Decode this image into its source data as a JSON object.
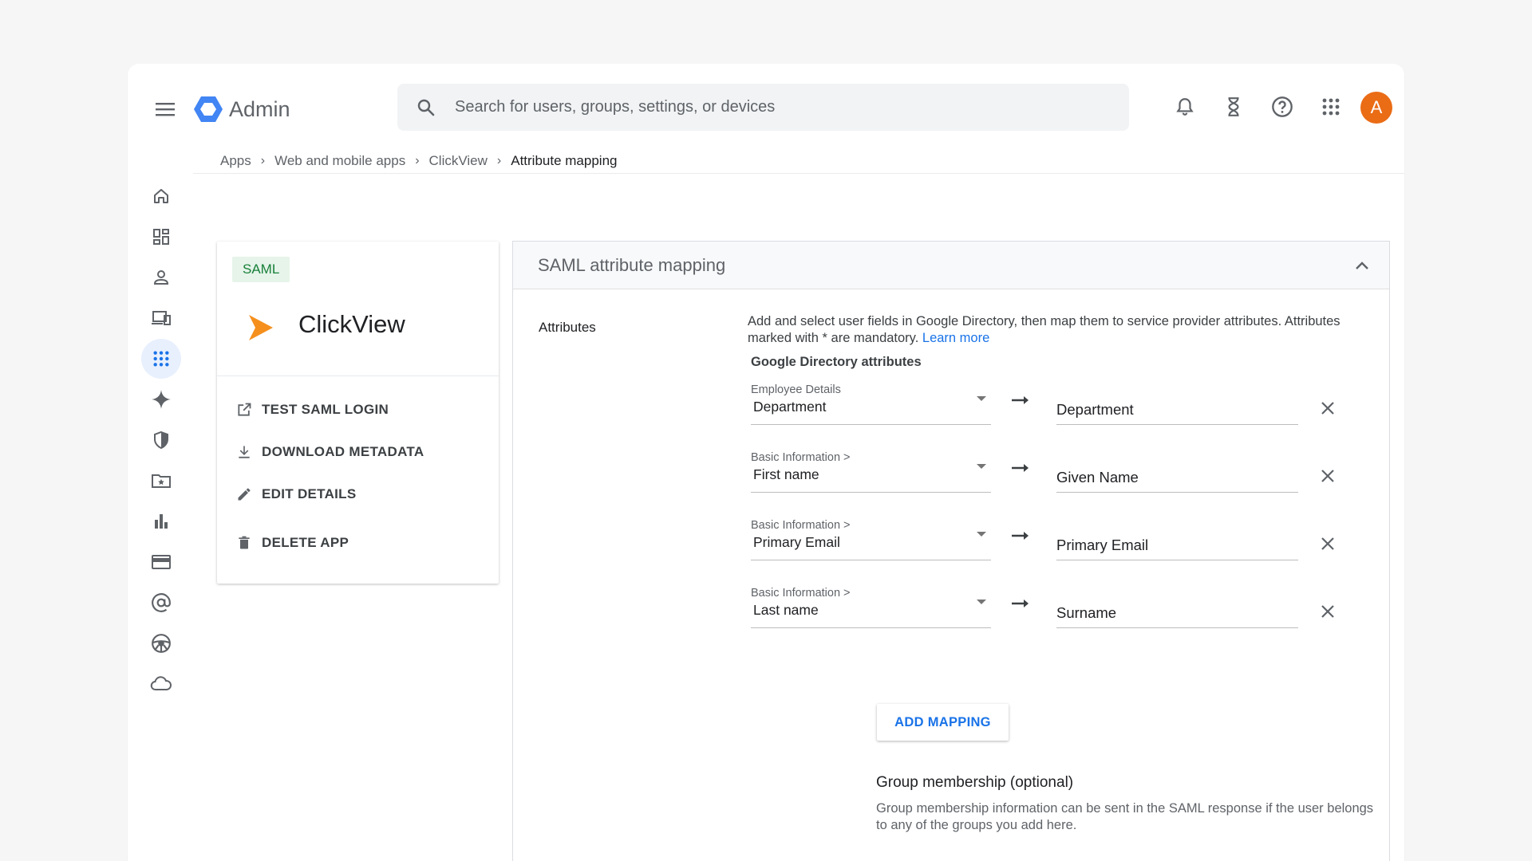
{
  "header": {
    "app_title": "Admin",
    "search_placeholder": "Search for users, groups, settings, or devices",
    "avatar_letter": "A"
  },
  "breadcrumb": [
    "Apps",
    "Web and mobile apps",
    "ClickView",
    "Attribute mapping"
  ],
  "nav": {
    "icons": [
      "home-icon",
      "dashboard-icon",
      "person-icon",
      "devices-icon",
      "apps-grid-icon",
      "sparkle-icon",
      "shield-icon",
      "folder-star-icon",
      "bar-chart-icon",
      "billing-card-icon",
      "at-sign-icon",
      "steering-wheel-icon",
      "cloud-icon"
    ],
    "active": "apps-grid-icon"
  },
  "app_card": {
    "chip": "SAML",
    "name": "ClickView",
    "actions": [
      "TEST SAML LOGIN",
      "DOWNLOAD METADATA",
      "EDIT DETAILS",
      "DELETE APP"
    ]
  },
  "panel": {
    "title": "SAML attribute mapping",
    "section_label": "Attributes",
    "description": "Add and select user fields in Google Directory, then map them to service provider attributes. Attributes marked with * are mandatory.",
    "learn_more": "Learn more",
    "directory_title": "Google Directory attributes",
    "mappings": [
      {
        "category": "Employee Details",
        "field": "Department",
        "sp_attribute": "Department"
      },
      {
        "category": "Basic Information >",
        "field": "First name",
        "sp_attribute": "Given Name"
      },
      {
        "category": "Basic Information >",
        "field": "Primary Email",
        "sp_attribute": "Primary Email"
      },
      {
        "category": "Basic Information >",
        "field": "Last name",
        "sp_attribute": "Surname"
      }
    ],
    "add_button": "ADD MAPPING",
    "group_title": "Group membership (optional)",
    "group_description": "Group membership information can be sent in the SAML response if the user belongs to any of the groups you add here."
  },
  "colors": {
    "accent": "#1a73e8",
    "avatar": "#ea6c15",
    "app_logo": "#f5901e",
    "chip_bg": "#e6f4ea",
    "chip_text": "#188038"
  }
}
